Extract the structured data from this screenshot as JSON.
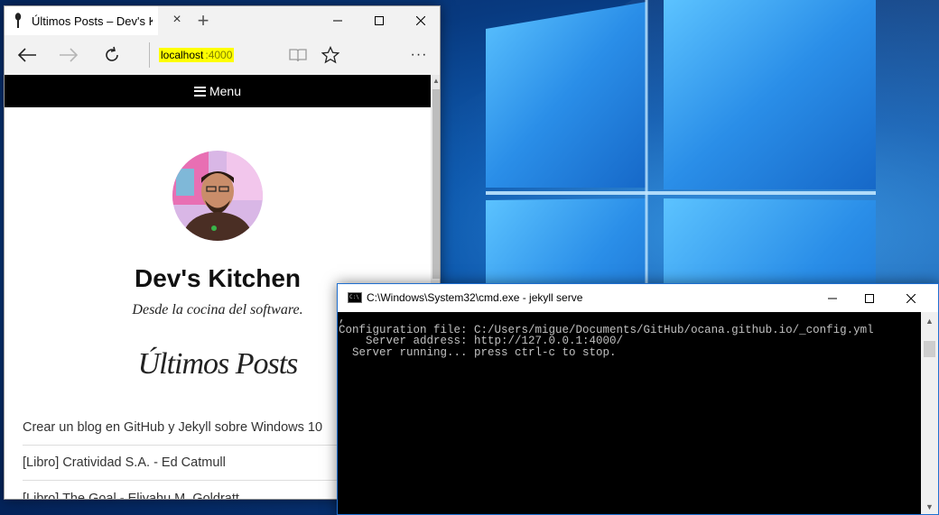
{
  "desktop": {
    "accent": "#0078d7"
  },
  "edge": {
    "tab_title": "Últimos Posts – Dev's Kitchen",
    "tab_close": "×",
    "new_tab": "+",
    "window_controls": {
      "minimize_icon": "minimize-icon",
      "maximize_icon": "maximize-icon",
      "close_icon": "close-icon"
    },
    "toolbar": {
      "back_icon": "back-arrow-icon",
      "forward_icon": "forward-arrow-icon",
      "refresh_icon": "refresh-icon",
      "reading_view_icon": "book-icon",
      "favorite_icon": "star-icon",
      "more_icon": "more-icon",
      "more_label": "···"
    },
    "address": {
      "host": "localhost",
      "port": ":4000"
    }
  },
  "site": {
    "nav_label": "Menu",
    "title": "Dev's Kitchen",
    "description": "Desde la cocina del software.",
    "posts_heading": "Últimos Posts",
    "posts": [
      {
        "title": "Crear un blog en GitHub y Jekyll sobre Windows 10"
      },
      {
        "title": "[Libro] Cratividad S.A. - Ed Catmull"
      },
      {
        "title": "[Libro] The Goal - Eliyahu M. Goldratt"
      }
    ]
  },
  "cmd": {
    "title": "C:\\Windows\\System32\\cmd.exe - jekyll  serve",
    "icon_label": "C:\\",
    "lines": [
      ",",
      "Configuration file: C:/Users/migue/Documents/GitHub/ocana.github.io/_config.yml",
      "    Server address: http://127.0.0.1:4000/",
      "  Server running... press ctrl-c to stop."
    ]
  }
}
